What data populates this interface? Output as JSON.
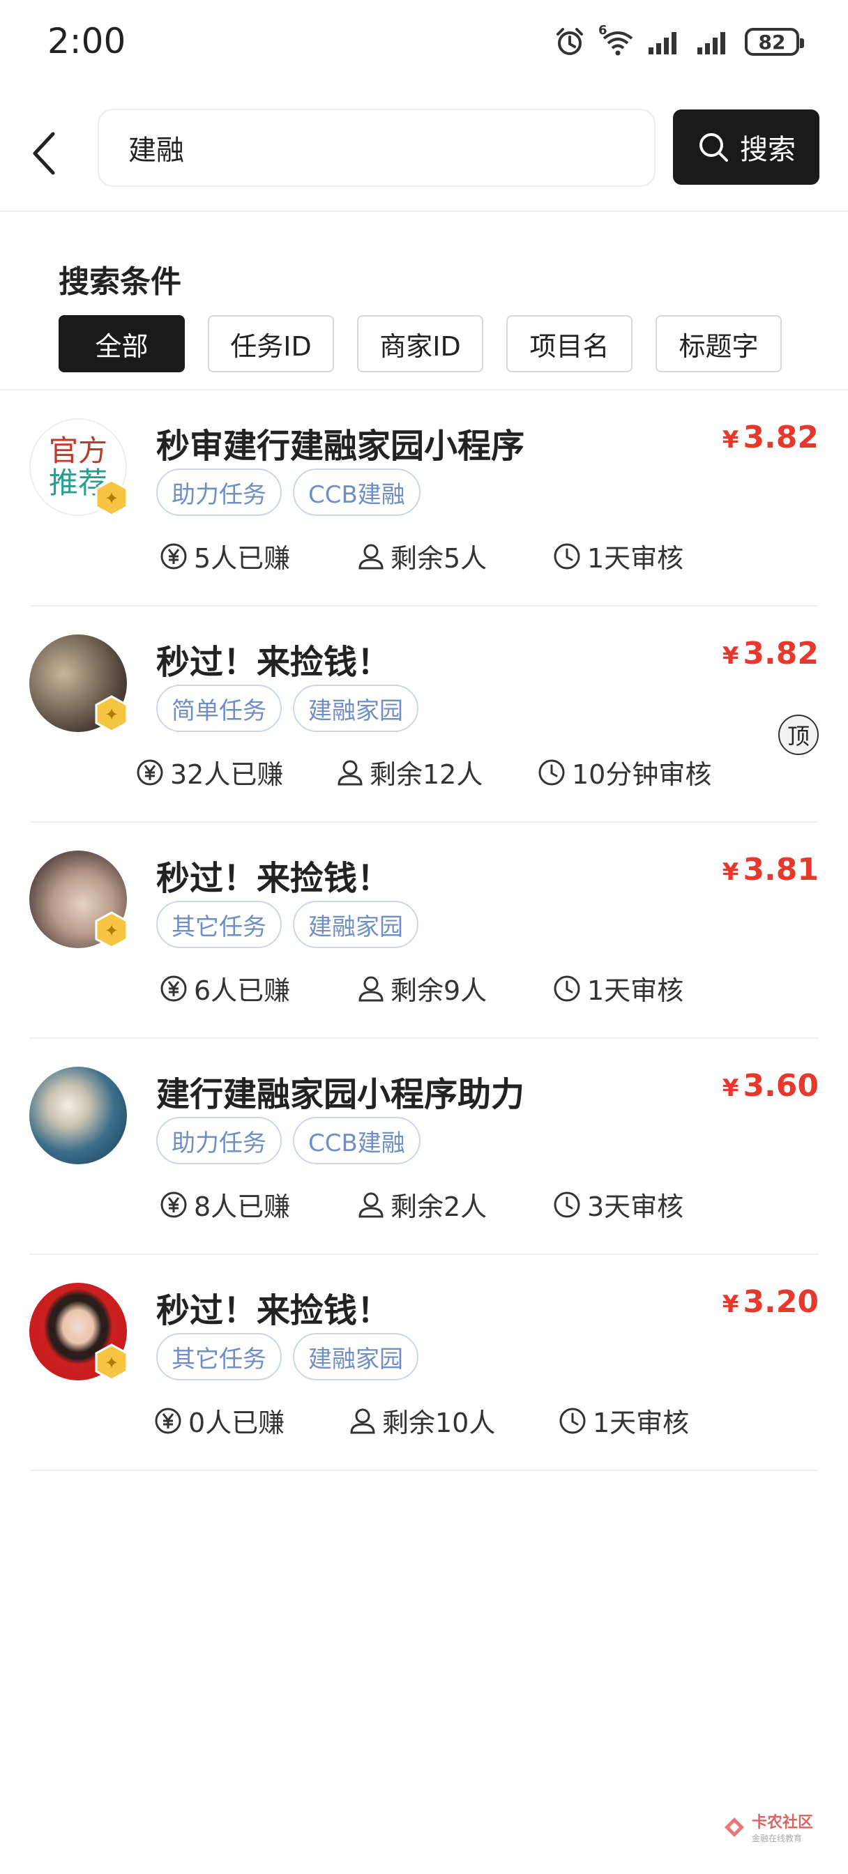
{
  "status_bar": {
    "time": "2:00",
    "network_label": "6",
    "battery": "82"
  },
  "search": {
    "value": "建融",
    "button_label": "搜索"
  },
  "filter": {
    "title": "搜索条件",
    "chips": [
      {
        "label": "全部",
        "active": true
      },
      {
        "label": "任务ID",
        "active": false
      },
      {
        "label": "商家ID",
        "active": false
      },
      {
        "label": "项目名",
        "active": false
      },
      {
        "label": "标题字",
        "active": false
      }
    ]
  },
  "tasks": [
    {
      "title": "秒审建行建融家园小程序",
      "currency": "¥",
      "price": "3.82",
      "avatar_text": [
        "官方",
        "推荐"
      ],
      "tags": [
        "助力任务",
        "CCB建融"
      ],
      "earned": "5人已赚",
      "remaining": "剩余5人",
      "review": "1天审核",
      "pinned_label": ""
    },
    {
      "title": "秒过！来捡钱！",
      "currency": "¥",
      "price": "3.82",
      "tags": [
        "简单任务",
        "建融家园"
      ],
      "earned": "32人已赚",
      "remaining": "剩余12人",
      "review": "10分钟审核",
      "pinned_label": "顶"
    },
    {
      "title": "秒过！来捡钱！",
      "currency": "¥",
      "price": "3.81",
      "tags": [
        "其它任务",
        "建融家园"
      ],
      "earned": "6人已赚",
      "remaining": "剩余9人",
      "review": "1天审核",
      "pinned_label": ""
    },
    {
      "title": "建行建融家园小程序助力",
      "currency": "¥",
      "price": "3.60",
      "tags": [
        "助力任务",
        "CCB建融"
      ],
      "earned": "8人已赚",
      "remaining": "剩余2人",
      "review": "3天审核",
      "pinned_label": ""
    },
    {
      "title": "秒过！来捡钱！",
      "currency": "¥",
      "price": "3.20",
      "tags": [
        "其它任务",
        "建融家园"
      ],
      "earned": "0人已赚",
      "remaining": "剩余10人",
      "review": "1天审核",
      "pinned_label": ""
    }
  ],
  "watermark": {
    "line1": "卡农社区",
    "line2": "金融在线教育"
  },
  "colors": {
    "accent": "#e8382d",
    "tag_text": "#6f8fc4",
    "tag_border": "#c9d6ee",
    "dark": "#1a1a1a"
  }
}
